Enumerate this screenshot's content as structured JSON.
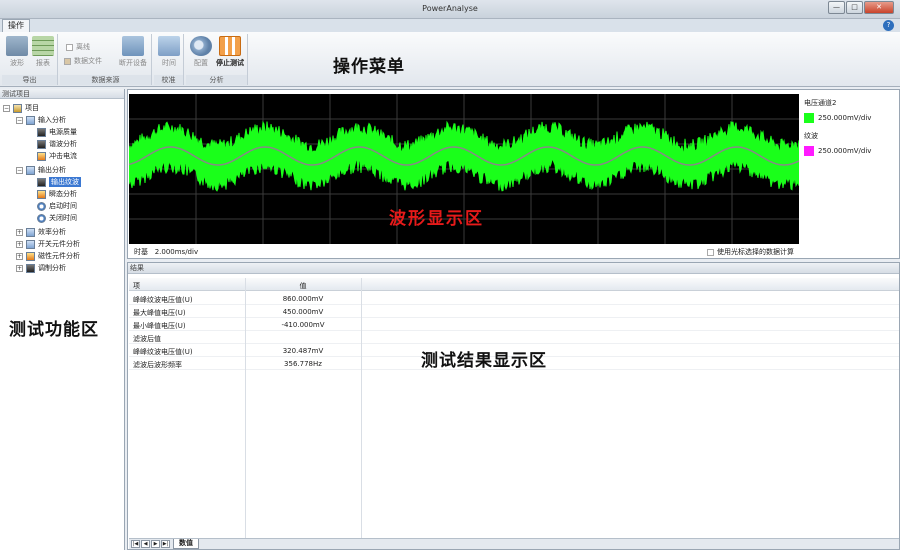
{
  "app": {
    "title": "PowerAnalyse",
    "window_buttons": [
      "—",
      "□",
      "✕"
    ]
  },
  "ribbon": {
    "tab_label": "操作",
    "help_icon": "?",
    "caption": "操作菜单",
    "groups": [
      {
        "label": "导出",
        "buttons": [
          {
            "label": "波形",
            "icon": "waveform-icon"
          },
          {
            "label": "报表",
            "icon": "table-icon"
          }
        ]
      },
      {
        "label": "数据来源",
        "checkbox_label": "离线",
        "buttons": [
          {
            "label": "数据文件",
            "icon": "data-file-icon"
          },
          {
            "label": "断开设备",
            "icon": "disconnect-device-icon"
          }
        ]
      },
      {
        "label": "校准",
        "buttons": [
          {
            "label": "时间",
            "icon": "time-calibrate-icon"
          }
        ]
      },
      {
        "label": "分析",
        "buttons": [
          {
            "label": "配置",
            "icon": "gears-icon"
          },
          {
            "label": "停止测试",
            "icon": "pause-icon"
          }
        ]
      }
    ]
  },
  "left_panel": {
    "header": "测试项目",
    "caption": "测试功能区",
    "tree": {
      "root": "项目",
      "input": {
        "label": "输入分析",
        "children": [
          "电源质量",
          "谐波分析",
          "冲击电流"
        ]
      },
      "output": {
        "label": "输出分析",
        "children": [
          "输出纹波",
          "瞬态分析",
          "启动时间",
          "关闭时间"
        ]
      },
      "collapsed": [
        "效率分析",
        "开关元件分析",
        "磁性元件分析",
        "调制分析"
      ]
    },
    "selected_item": "输出纹波"
  },
  "waveform": {
    "caption": "波形显示区",
    "legend": [
      {
        "name": "电压通道2",
        "scale": "250.000mV/div",
        "color": "#1aff1a"
      },
      {
        "name": "纹波",
        "scale": "250.000mV/div",
        "color": "#ff1aff"
      }
    ],
    "timebase_label": "时基",
    "timebase_value": "2.000ms/div",
    "cursor_checkbox_label": "使用光标选择的数据计算"
  },
  "results": {
    "header": "结果",
    "caption": "测试结果显示区",
    "columns": [
      "项",
      "值"
    ],
    "rows": [
      {
        "item": "峰峰纹波电压值(U)",
        "value": "860.000mV"
      },
      {
        "item": "最大峰值电压(U)",
        "value": "450.000mV"
      },
      {
        "item": "最小峰值电压(U)",
        "value": "-410.000mV"
      },
      {
        "item": "滤波后值",
        "value": ""
      },
      {
        "item": "峰峰纹波电压值(U)",
        "value": "320.487mV"
      },
      {
        "item": "滤波后波形频率",
        "value": "356.778Hz"
      }
    ],
    "sheet_tab": "数值",
    "nav_buttons": [
      "|◀",
      "◀",
      "▶",
      "▶|"
    ]
  }
}
